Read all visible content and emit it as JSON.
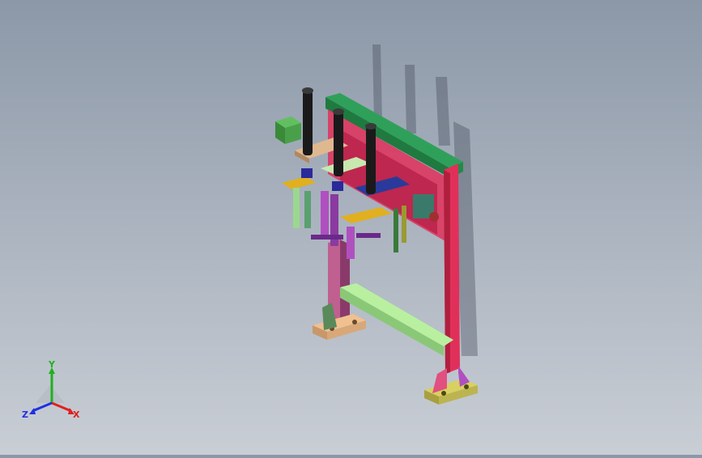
{
  "viewport": {
    "background_top": "#8c98a8",
    "background_bottom": "#c9ced5"
  },
  "model": {
    "description_icon": "machine-assembly",
    "part_colors": {
      "frame_top": "#2fa05a",
      "frame_post": "#e0305a",
      "crossbar": "#b8f0a0",
      "base_plate": "#f0c090",
      "foot_plate": "#d8d060",
      "cylinder": "#1a1a1a",
      "bracket_purple": "#b050c0",
      "bracket_blue": "#2a3a9a",
      "bracket_yellow": "#e0b020",
      "motor_green": "#60c060"
    }
  },
  "triad": {
    "y_label": "Y",
    "x_label": "X",
    "z_label": "Z",
    "y_color": "#20b020",
    "x_color": "#e02020",
    "z_color": "#2030e0"
  }
}
